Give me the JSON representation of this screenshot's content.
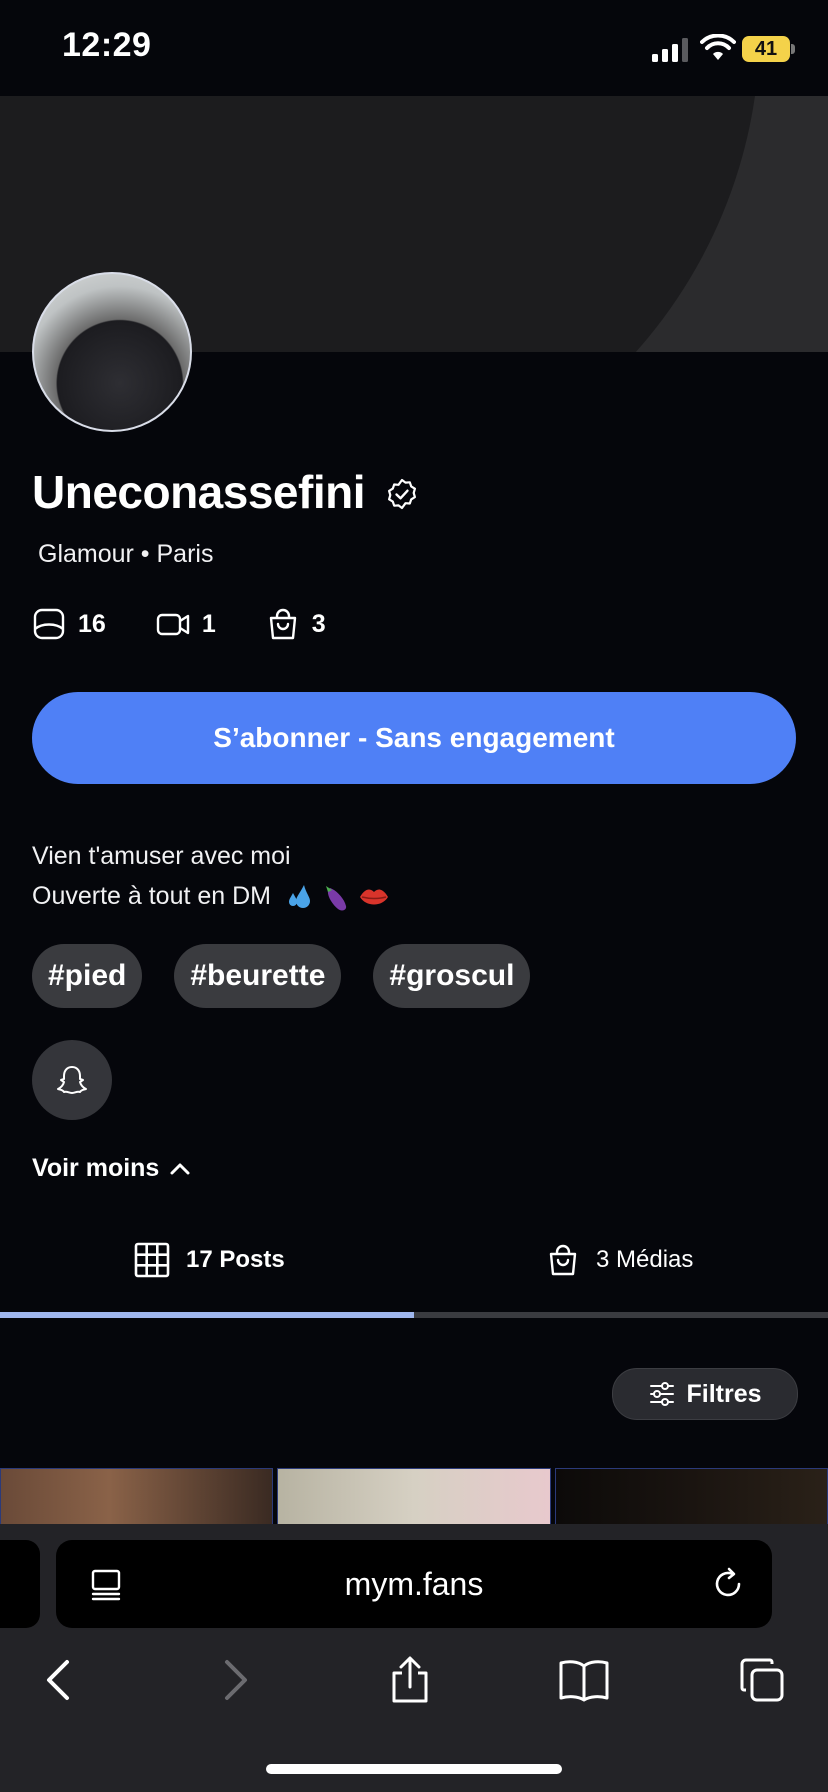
{
  "status_bar": {
    "time": "12:29",
    "battery": "41"
  },
  "profile": {
    "name": "Uneconassefini",
    "meta": "Glamour • Paris",
    "stats": {
      "photos": "16",
      "videos": "1",
      "purchases": "3"
    },
    "subscribe_label": "S’abonner - Sans engagement",
    "bio_line1": "Vien t'amuser avec moi",
    "bio_line2": "Ouverte à tout en DM",
    "tags": [
      "#pied",
      "#beurette",
      "#groscul"
    ],
    "see_less": "Voir moins"
  },
  "tabs": [
    {
      "label": "17 Posts",
      "active": true
    },
    {
      "label": "3 Médias",
      "active": false
    }
  ],
  "filters_label": "Filtres",
  "browser": {
    "url": "mym.fans"
  },
  "colors": {
    "accent": "#4f80f6",
    "tab_active": "#9fb6ee",
    "battery": "#f4d24a"
  }
}
